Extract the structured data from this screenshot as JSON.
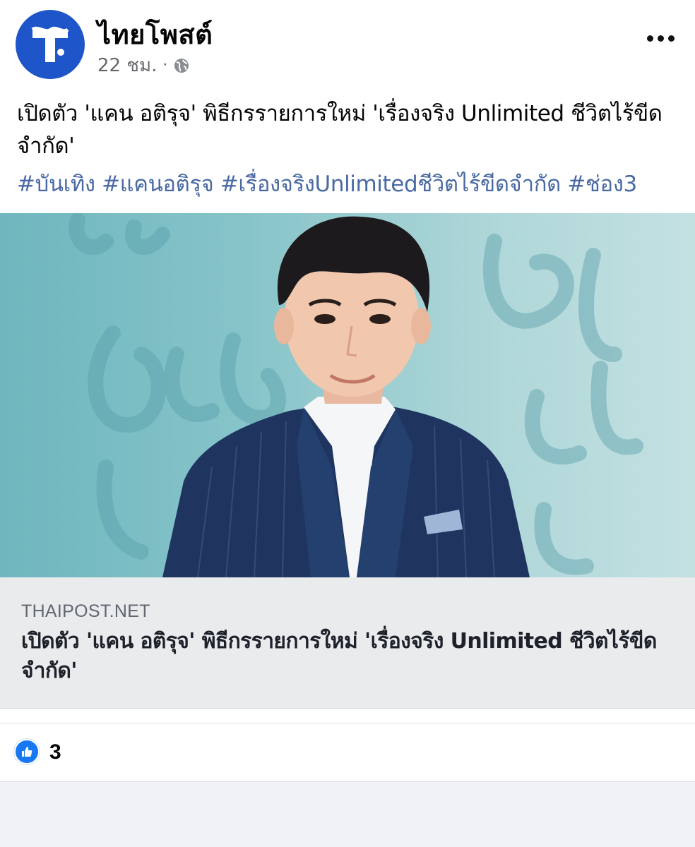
{
  "page": {
    "name": "ไทยโพสต์",
    "time": "22 ชม.",
    "separator": "·",
    "privacy_icon": "globe-icon",
    "avatar_icon": "thaipost-logo",
    "avatar_color": "#1e55c8"
  },
  "post": {
    "text": "เปิดตัว 'แคน อติรุจ' พิธีกรรายการใหม่ 'เรื่องจริง Unlimited ชีวิตไร้ขีดจำกัด'",
    "hashtags": [
      "#บันเทิง",
      "#แคนอติรุจ",
      "#เรื่องจริงUnlimitedชีวิตไร้ขีดจำกัด",
      "#ช่อง3"
    ]
  },
  "link": {
    "domain": "THAIPOST.NET",
    "title": "เปิดตัว 'แคน อติรุจ' พิธีกรรายการใหม่ 'เรื่องจริง Unlimited ชีวิตไร้ขีดจำกัด'",
    "image_description_icon": "host-photo"
  },
  "reactions": {
    "icon": "thumbs-up-icon",
    "count": "3",
    "accent": "#1877f2"
  },
  "colors": {
    "hashtag": "#4a6aa3",
    "meta": "#65676b",
    "card_bg": "#eaebed"
  }
}
